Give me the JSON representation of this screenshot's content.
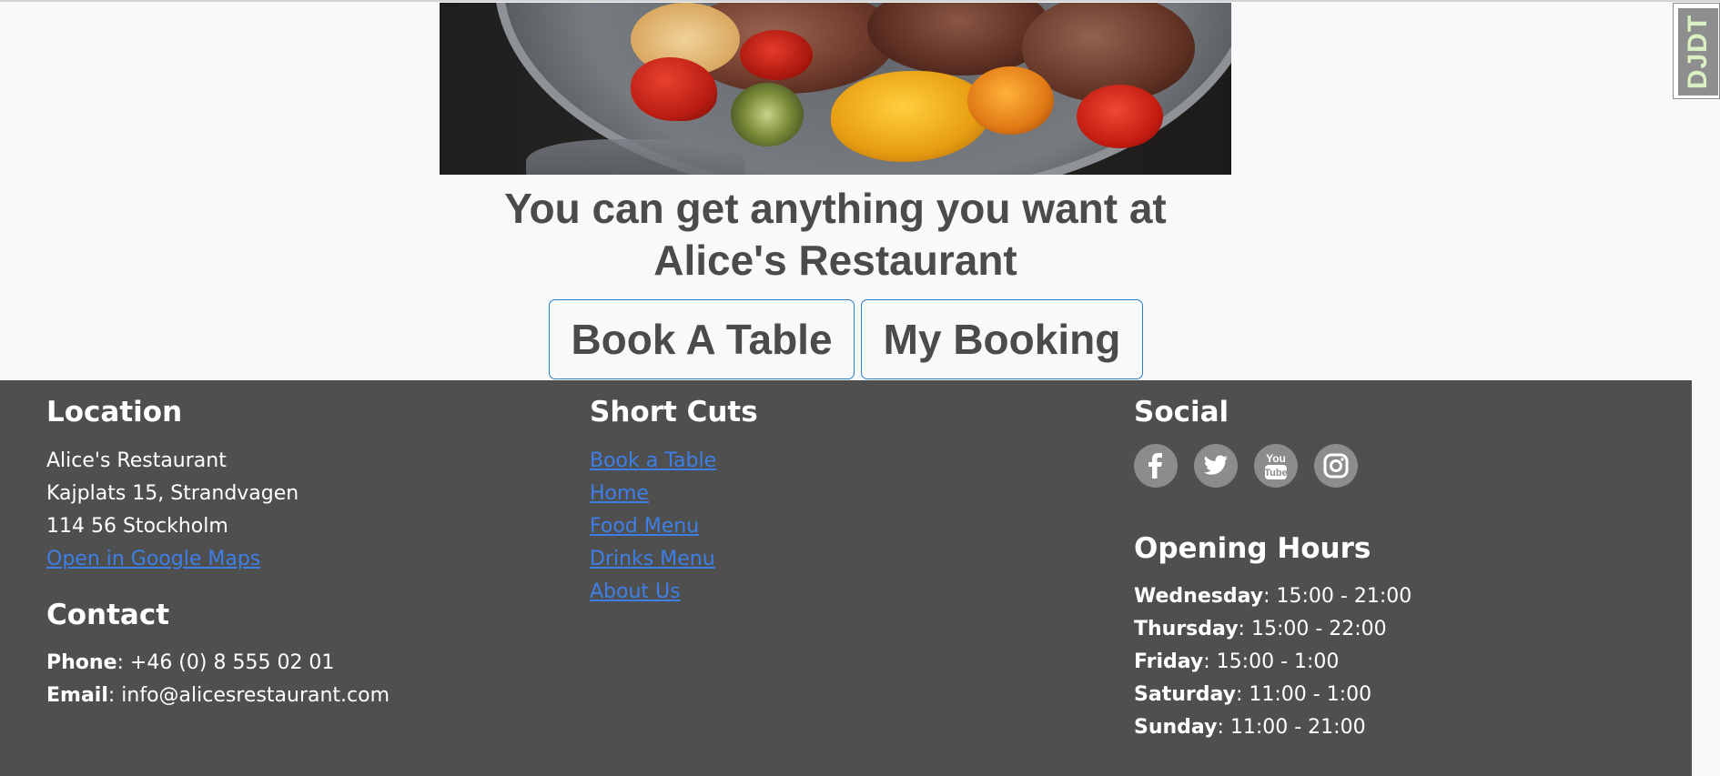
{
  "hero": {
    "image_alt": "Roast lamb with grilled peppers and zucchini on a plate"
  },
  "headline": "You can get anything you want at Alice's Restaurant",
  "cta": {
    "book_label": "Book A Table",
    "my_booking_label": "My Booking"
  },
  "debug_toolbar": {
    "label": "DJDT"
  },
  "footer": {
    "location": {
      "heading": "Location",
      "name": "Alice's Restaurant",
      "street": "Kajplats 15, Strandvagen",
      "city": "114 56 Stockholm",
      "maps_link": "Open in Google Maps"
    },
    "contact": {
      "heading": "Contact",
      "phone_label": "Phone",
      "phone_value": ": +46 (0) 8 555 02 01",
      "email_label": "Email",
      "email_value": ": info@alicesrestaurant.com"
    },
    "shortcuts": {
      "heading": "Short Cuts",
      "links": [
        "Book a Table",
        "Home",
        "Food Menu",
        "Drinks Menu",
        "About Us"
      ]
    },
    "social": {
      "heading": "Social",
      "icons": [
        "facebook-icon",
        "twitter-icon",
        "youtube-icon",
        "instagram-icon"
      ],
      "youtube_text_top": "You",
      "youtube_text_bottom": "Tube"
    },
    "hours": {
      "heading": "Opening Hours",
      "days": [
        {
          "day": "Wednesday",
          "time": ": 15:00 - 21:00"
        },
        {
          "day": "Thursday",
          "time": ": 15:00 - 22:00"
        },
        {
          "day": "Friday",
          "time": ": 15:00 - 1:00"
        },
        {
          "day": "Saturday",
          "time": ": 11:00 - 1:00"
        },
        {
          "day": "Sunday",
          "time": ": 11:00 - 21:00"
        }
      ]
    }
  },
  "colors": {
    "page_bg": "#f8f9fa",
    "footer_bg": "#4f4f4f",
    "link": "#3d7fe6",
    "button_border": "#2f7fc4",
    "heading_text": "#4b4b4b"
  }
}
